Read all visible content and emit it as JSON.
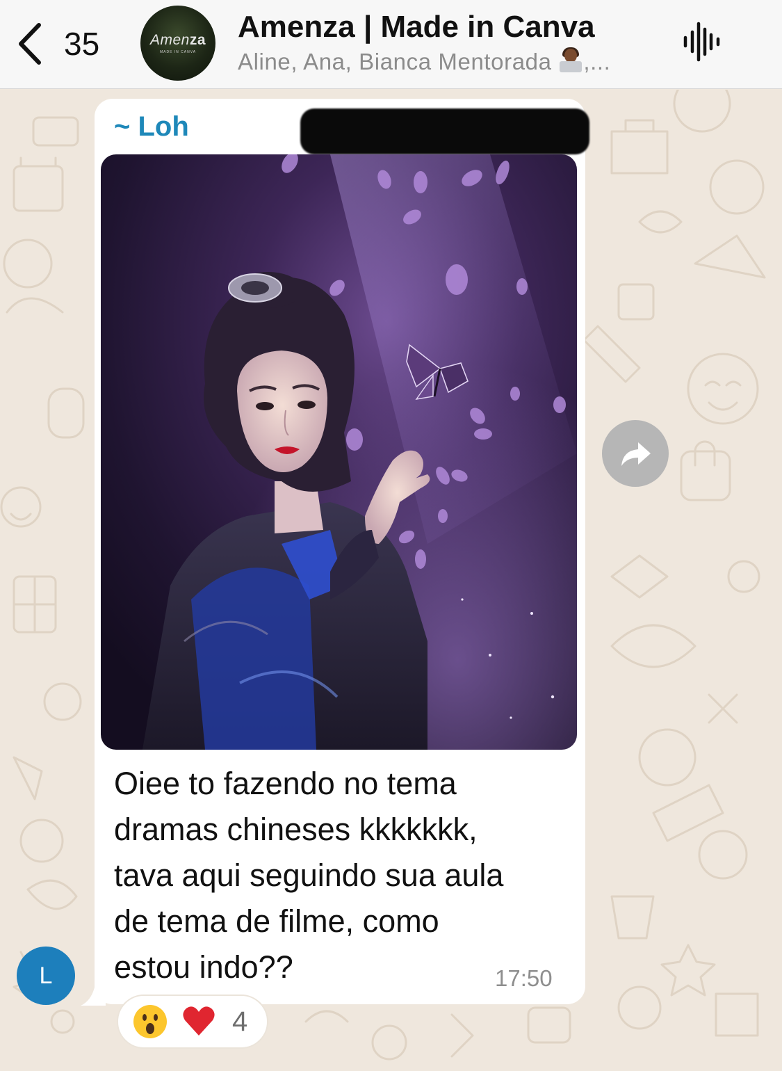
{
  "header": {
    "back_count": "35",
    "group_logo_text_light": "Amen",
    "group_logo_text_bold": "za",
    "group_logo_subtext": "MADE IN CANVA",
    "title": "Amenza | Made in Canva",
    "subtitle": "Aline, Ana, Bianca Mentorada",
    "subtitle_suffix": ",..."
  },
  "message": {
    "sender": "~ Loh",
    "text": "Oiee to fazendo no tema\ndramas chineses kkkkkkk,\ntava aqui seguindo sua aula\nde tema de filme, como\nestou indo??",
    "time": "17:50",
    "sender_initial": "L",
    "reaction_count": "4"
  },
  "icons": {
    "back": "chevron-left-icon",
    "voice": "audio-wave-icon",
    "forward": "forward-arrow-icon",
    "reaction_1": "astonished-face-emoji",
    "reaction_2": "red-heart-emoji"
  },
  "colors": {
    "header_bg": "#f7f7f7",
    "wallpaper": "#efe7dd",
    "sender_name": "#1e88b9",
    "avatar_bg": "#1d7fbc"
  }
}
